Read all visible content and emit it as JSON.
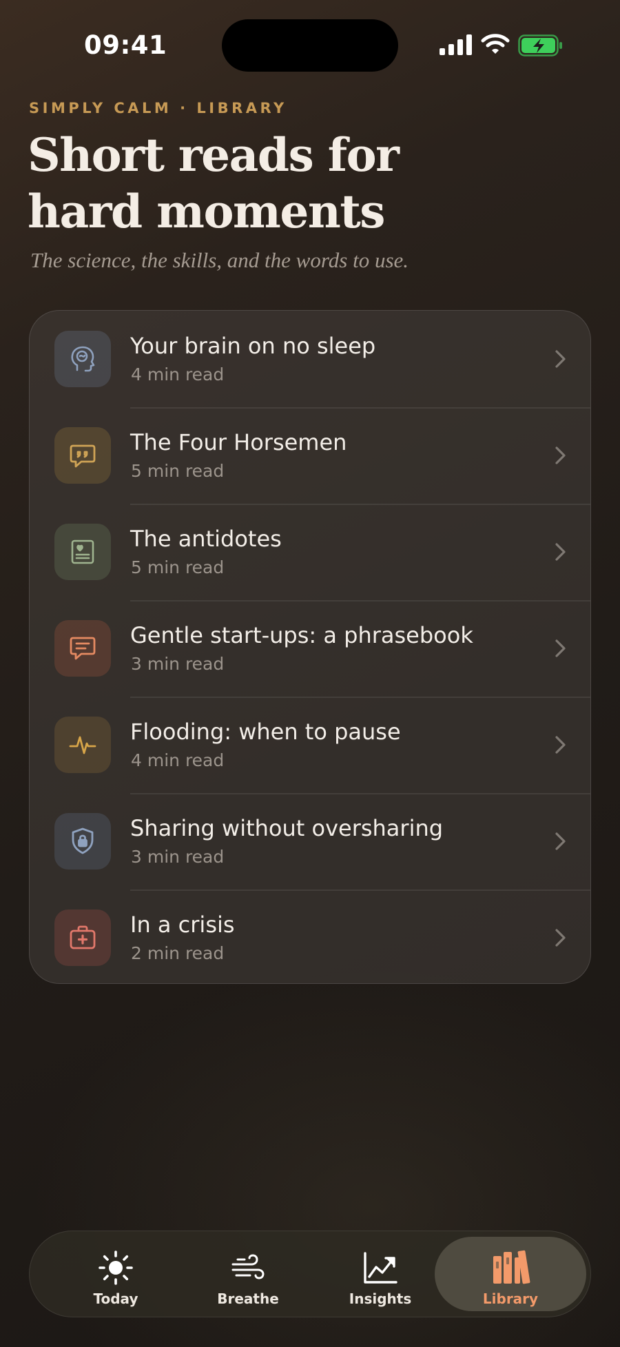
{
  "status": {
    "time": "09:41"
  },
  "header": {
    "eyebrow": "SIMPLY CALM · LIBRARY",
    "title": "Short reads for hard moments",
    "subtitle": "The science, the skills, and the words to use."
  },
  "articles": [
    {
      "title": "Your brain on no sleep",
      "meta": "4 min read",
      "icon": "brain-icon",
      "tint": "#8fa2bf"
    },
    {
      "title": "The Four Horsemen",
      "meta": "5 min read",
      "icon": "quote-bubble-icon",
      "tint": "#d0a456"
    },
    {
      "title": "The antidotes",
      "meta": "5 min read",
      "icon": "heart-note-icon",
      "tint": "#9fb48f"
    },
    {
      "title": "Gentle start-ups: a phrasebook",
      "meta": "3 min read",
      "icon": "message-lines-icon",
      "tint": "#e58a62"
    },
    {
      "title": "Flooding: when to pause",
      "meta": "4 min read",
      "icon": "pulse-icon",
      "tint": "#d7a549"
    },
    {
      "title": "Sharing without oversharing",
      "meta": "3 min read",
      "icon": "shield-lock-icon",
      "tint": "#8fa2bf"
    },
    {
      "title": "In a crisis",
      "meta": "2 min read",
      "icon": "first-aid-kit-icon",
      "tint": "#e2786b"
    }
  ],
  "tabs": [
    {
      "label": "Today",
      "icon": "sun-icon"
    },
    {
      "label": "Breathe",
      "icon": "wind-icon"
    },
    {
      "label": "Insights",
      "icon": "trend-chart-icon"
    },
    {
      "label": "Library",
      "icon": "books-icon",
      "active": true
    }
  ],
  "colors": {
    "accent": "#f39a6a",
    "eyebrow": "#c79a55",
    "battery": "#3ecf5b"
  }
}
